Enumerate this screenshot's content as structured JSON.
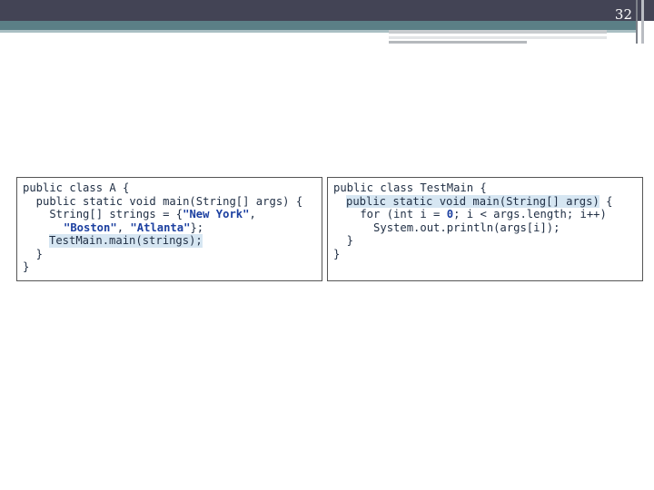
{
  "slide": {
    "number": "32"
  },
  "left_panel": {
    "lines": {
      "l1": "public class A {",
      "l2": "  public static void main(String[] args) {",
      "l3a": "    String[] strings = {",
      "l3s": "\"New York\"",
      "l3b": ",",
      "l4s1": "\"Boston\"",
      "l4m": ", ",
      "l4s2": "\"Atlanta\"",
      "l4e": "};",
      "l5": "TestMain.main(strings);",
      "l6": "  }",
      "l7": "}"
    }
  },
  "right_panel": {
    "lines": {
      "l1": "public class TestMain {",
      "l2": "public static void main(String[] args)",
      "l2e": " {",
      "l3a": "    for (int i = ",
      "l3n": "0",
      "l3b": "; i < args.length; i++)",
      "l4": "      System.out.println(args[i]);",
      "l5": "  }",
      "l6": "}"
    }
  }
}
